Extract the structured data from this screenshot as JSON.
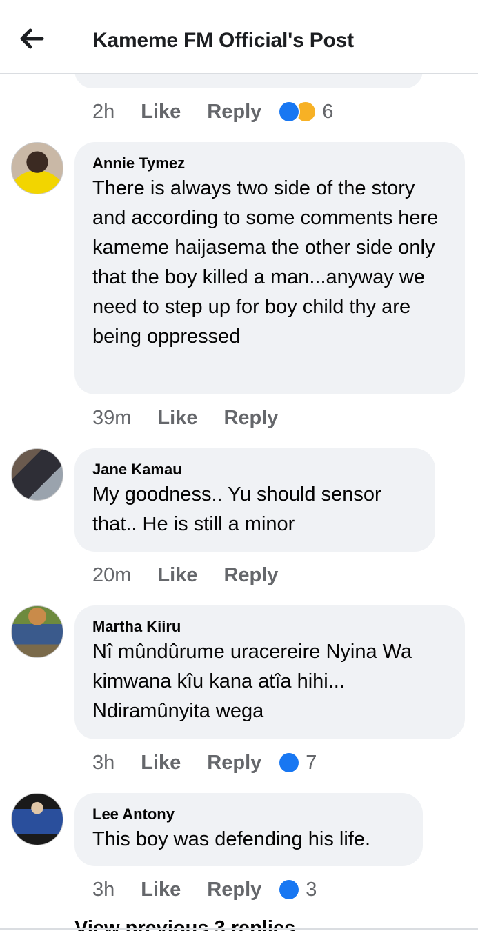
{
  "header": {
    "title": "Kameme FM Official's Post",
    "back_icon": "arrow-left-icon"
  },
  "colors": {
    "like_blue": "#1877f2",
    "haha_yellow": "#f7b125",
    "bubble_bg": "#f0f2f5",
    "meta_gray": "#65676b"
  },
  "actions": {
    "like": "Like",
    "reply": "Reply"
  },
  "prev_comment": {
    "time": "2h",
    "reaction_count": "6"
  },
  "comments": [
    {
      "author": "Annie Tymez",
      "text": "There is always two side of the story and according to some comments here kameme haijasema the other side only that the boy killed a man...anyway we need to step up for boy child thy are being oppressed",
      "time": "39m"
    },
    {
      "author": "Jane Kamau",
      "text": "My goodness.. Yu should sensor that.. He is still a minor",
      "time": "20m"
    },
    {
      "author": "Martha Kiiru",
      "text": "Nî mûndûrume uracereire Nyina Wa kimwana kîu kana atîa hihi... Ndiramûnyita wega",
      "time": "3h",
      "reaction_count": "7"
    },
    {
      "author": "Lee Antony",
      "text": "This boy was defending his life.",
      "time": "3h",
      "reaction_count": "3"
    }
  ],
  "view_more": "View previous 3 replies"
}
